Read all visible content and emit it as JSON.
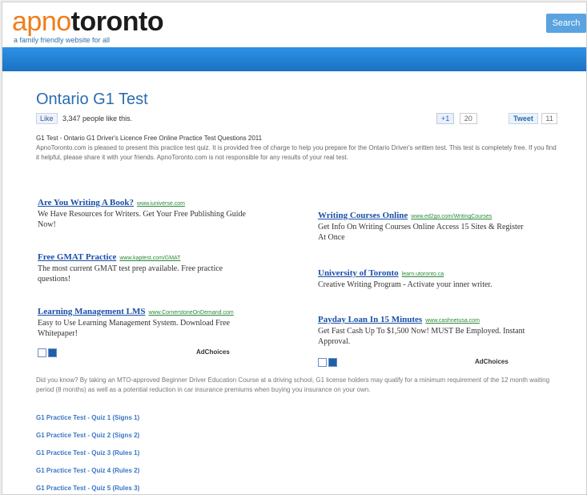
{
  "header": {
    "logo_part1": "apno",
    "logo_part2": "toronto",
    "tagline": "a family friendly website for all",
    "search_button": "Search"
  },
  "page": {
    "title": "Ontario G1 Test",
    "fb_like_label": "Like",
    "fb_like_count": "3,347 people like this.",
    "gplus_label": "+1",
    "gplus_count": "20",
    "tweet_label": "Tweet",
    "tweet_count": "11",
    "intro_heading": "G1 Test - Ontario G1 Driver's Licence Free Online Practice Test Questions 2011",
    "intro_body": "ApnoToronto.com is pleased to present this practice test quiz. It is provided free of charge to help you prepare for the Ontario Driver's written test. This test is completely free. If you find it helpful, please share it with your friends. ApnoToronto.com is not responsible for any results of your real test."
  },
  "ads_left": [
    {
      "title": "Are You Writing A Book?",
      "url": "www.iuniverse.com",
      "desc": "We Have Resources for Writers. Get Your Free Publishing Guide Now!"
    },
    {
      "title": "Free GMAT Practice",
      "url": "www.kaptest.com/GMAT",
      "desc": "The most current GMAT test prep available. Free practice questions!"
    },
    {
      "title": "Learning Management LMS",
      "url": "www.CornerstoneOnDemand.com",
      "desc": "Easy to Use Learning Management System. Download Free Whitepaper!"
    }
  ],
  "ads_right": [
    {
      "title": "Writing Courses Online",
      "url": "www.ed2go.com/WritingCourses",
      "desc": "Get Info On Writing Courses Online Access 15 Sites & Register At Once"
    },
    {
      "title": "University of Toronto",
      "url": "learn.utoronto.ca",
      "desc": "Creative Writing Program - Activate your inner writer."
    },
    {
      "title": "Payday Loan In 15 Minutes",
      "url": "www.cashnetusa.com",
      "desc": "Get Fast Cash Up To $1,500 Now! MUST Be Employed. Instant Approval."
    }
  ],
  "adchoices_label": "AdChoices",
  "adnav_1": "1",
  "adnav_2": "2",
  "body_para": "Did you know? By taking an MTO-approved Beginner Driver Education Course at a driving school, G1 license holders may qualify for a minimum requirement of the 12 month waiting period (8 months) as well as a potential reduction in car insurance premiums when buying you insurance on your own.",
  "quizzes": [
    "G1 Practice Test - Quiz 1 (Signs 1)",
    "G1 Practice Test - Quiz 2 (Signs 2)",
    "G1 Practice Test - Quiz 3 (Rules 1)",
    "G1 Practice Test - Quiz 4 (Rules 2)",
    "G1 Practice Test - Quiz 5 (Rules 3)"
  ]
}
